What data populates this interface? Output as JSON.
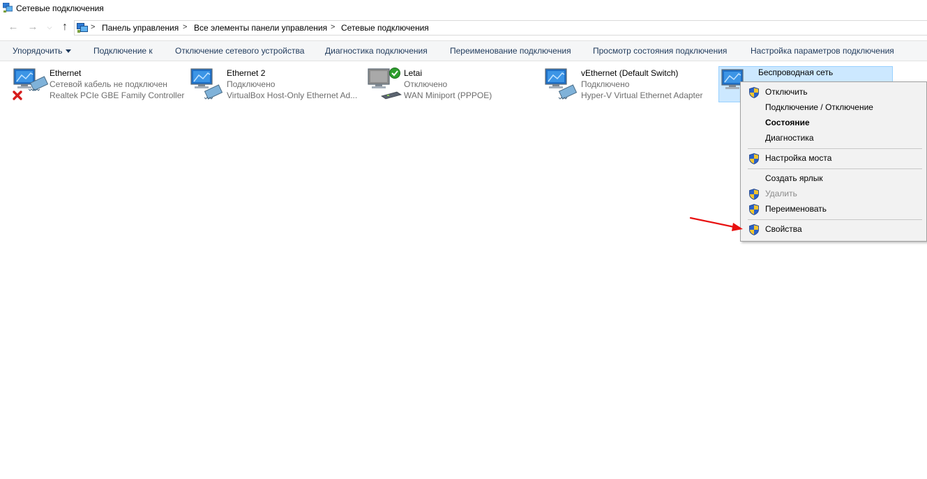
{
  "window": {
    "title": "Сетевые подключения"
  },
  "navigation": {
    "breadcrumb": [
      "Панель управления",
      "Все элементы панели управления",
      "Сетевые подключения"
    ]
  },
  "commands": [
    "Упорядочить",
    "Подключение к",
    "Отключение сетевого устройства",
    "Диагностика подключения",
    "Переименование подключения",
    "Просмотр состояния подключения",
    "Настройка параметров подключения"
  ],
  "connections": [
    {
      "name": "Ethernet",
      "status": "Сетевой кабель не подключен",
      "device": "Realtek PCIe GBE Family Controller",
      "icon": "ethernet-disconnected-icon"
    },
    {
      "name": "Ethernet 2",
      "status": "Подключено",
      "device": "VirtualBox Host-Only Ethernet Ad...",
      "icon": "ethernet-icon"
    },
    {
      "name": "Letai",
      "status": "Отключено",
      "device": "WAN Miniport (PPPOE)",
      "icon": "dialup-connection-icon"
    },
    {
      "name": "vEthernet (Default Switch)",
      "status": "Подключено",
      "device": "Hyper-V Virtual Ethernet Adapter",
      "icon": "ethernet-icon"
    },
    {
      "name": "Беспроводная сеть",
      "status": "",
      "device": "",
      "icon": "wireless-network-icon"
    }
  ],
  "context_menu": {
    "items": [
      "Отключить",
      "Подключение / Отключение",
      "Состояние",
      "Диагностика",
      "Настройка моста",
      "Создать ярлык",
      "Удалить",
      "Переименовать",
      "Свойства"
    ]
  },
  "colors": {
    "selection_bg": "#cce8ff",
    "selection_border": "#99d1ff",
    "command_text": "#1e395b",
    "annotation_arrow": "#e81010"
  }
}
